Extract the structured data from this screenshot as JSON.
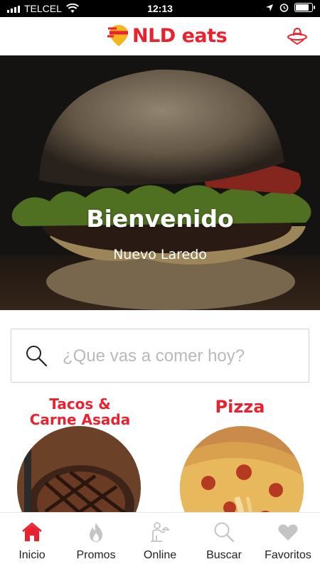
{
  "status_bar": {
    "carrier": "TELCEL",
    "time": "12:13",
    "battery_level": 0.85
  },
  "header": {
    "brand_prefix": "NLD",
    "brand_suffix": "eats"
  },
  "hero": {
    "title": "Bienvenido",
    "subtitle": "Nuevo Laredo"
  },
  "search": {
    "placeholder": "¿Que vas a comer hoy?"
  },
  "categories": [
    {
      "title_line1": "Tacos &",
      "title_line2": "Carne Asada"
    },
    {
      "title": "Pizza"
    }
  ],
  "nav": {
    "items": [
      {
        "label": "Inicio",
        "icon": "home-icon",
        "active": true
      },
      {
        "label": "Promos",
        "icon": "flame-icon"
      },
      {
        "label": "Online",
        "icon": "waiter-icon"
      },
      {
        "label": "Buscar",
        "icon": "search-icon"
      },
      {
        "label": "Favoritos",
        "icon": "heart-icon"
      }
    ]
  },
  "colors": {
    "brand_red": "#e8232f",
    "brand_yellow": "#f5b521",
    "nav_inactive": "#c4c4c4"
  }
}
